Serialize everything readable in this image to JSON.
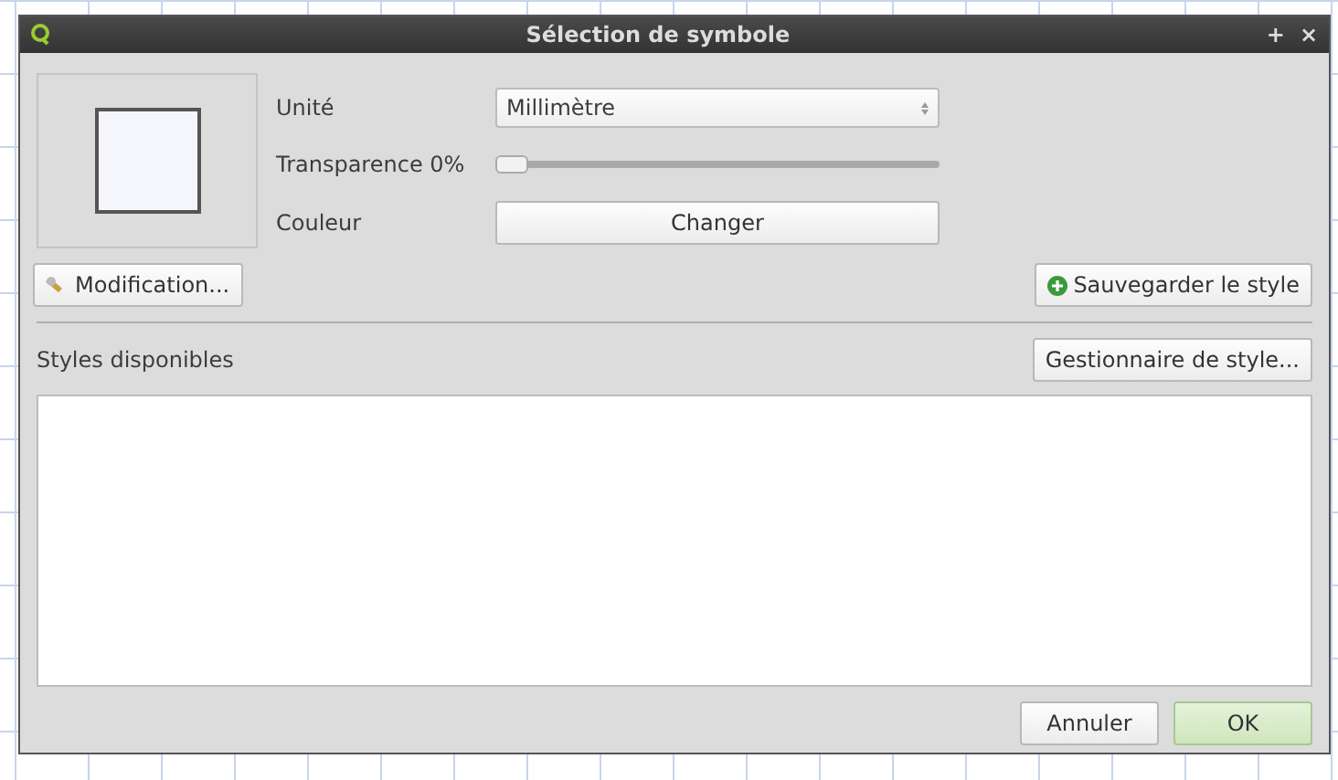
{
  "window": {
    "title": "Sélection de symbole",
    "buttons": [
      "+",
      "×"
    ]
  },
  "symbol": {
    "edit_button": "Modification...",
    "save_button": "Sauvegarder le style"
  },
  "fields": [
    {
      "kind": "combo",
      "label": "Unité",
      "value": "Millimètre"
    },
    {
      "kind": "slider",
      "label": "Transparence 0%",
      "level": 0
    },
    {
      "kind": "button",
      "label": "Couleur",
      "value": "Changer"
    }
  ],
  "styles": {
    "label": "Styles disponibles",
    "manager_button": "Gestionnaire de style..."
  },
  "buttons": [
    {
      "label": "Annuler",
      "default": false
    },
    {
      "label": "OK",
      "default": true
    }
  ]
}
